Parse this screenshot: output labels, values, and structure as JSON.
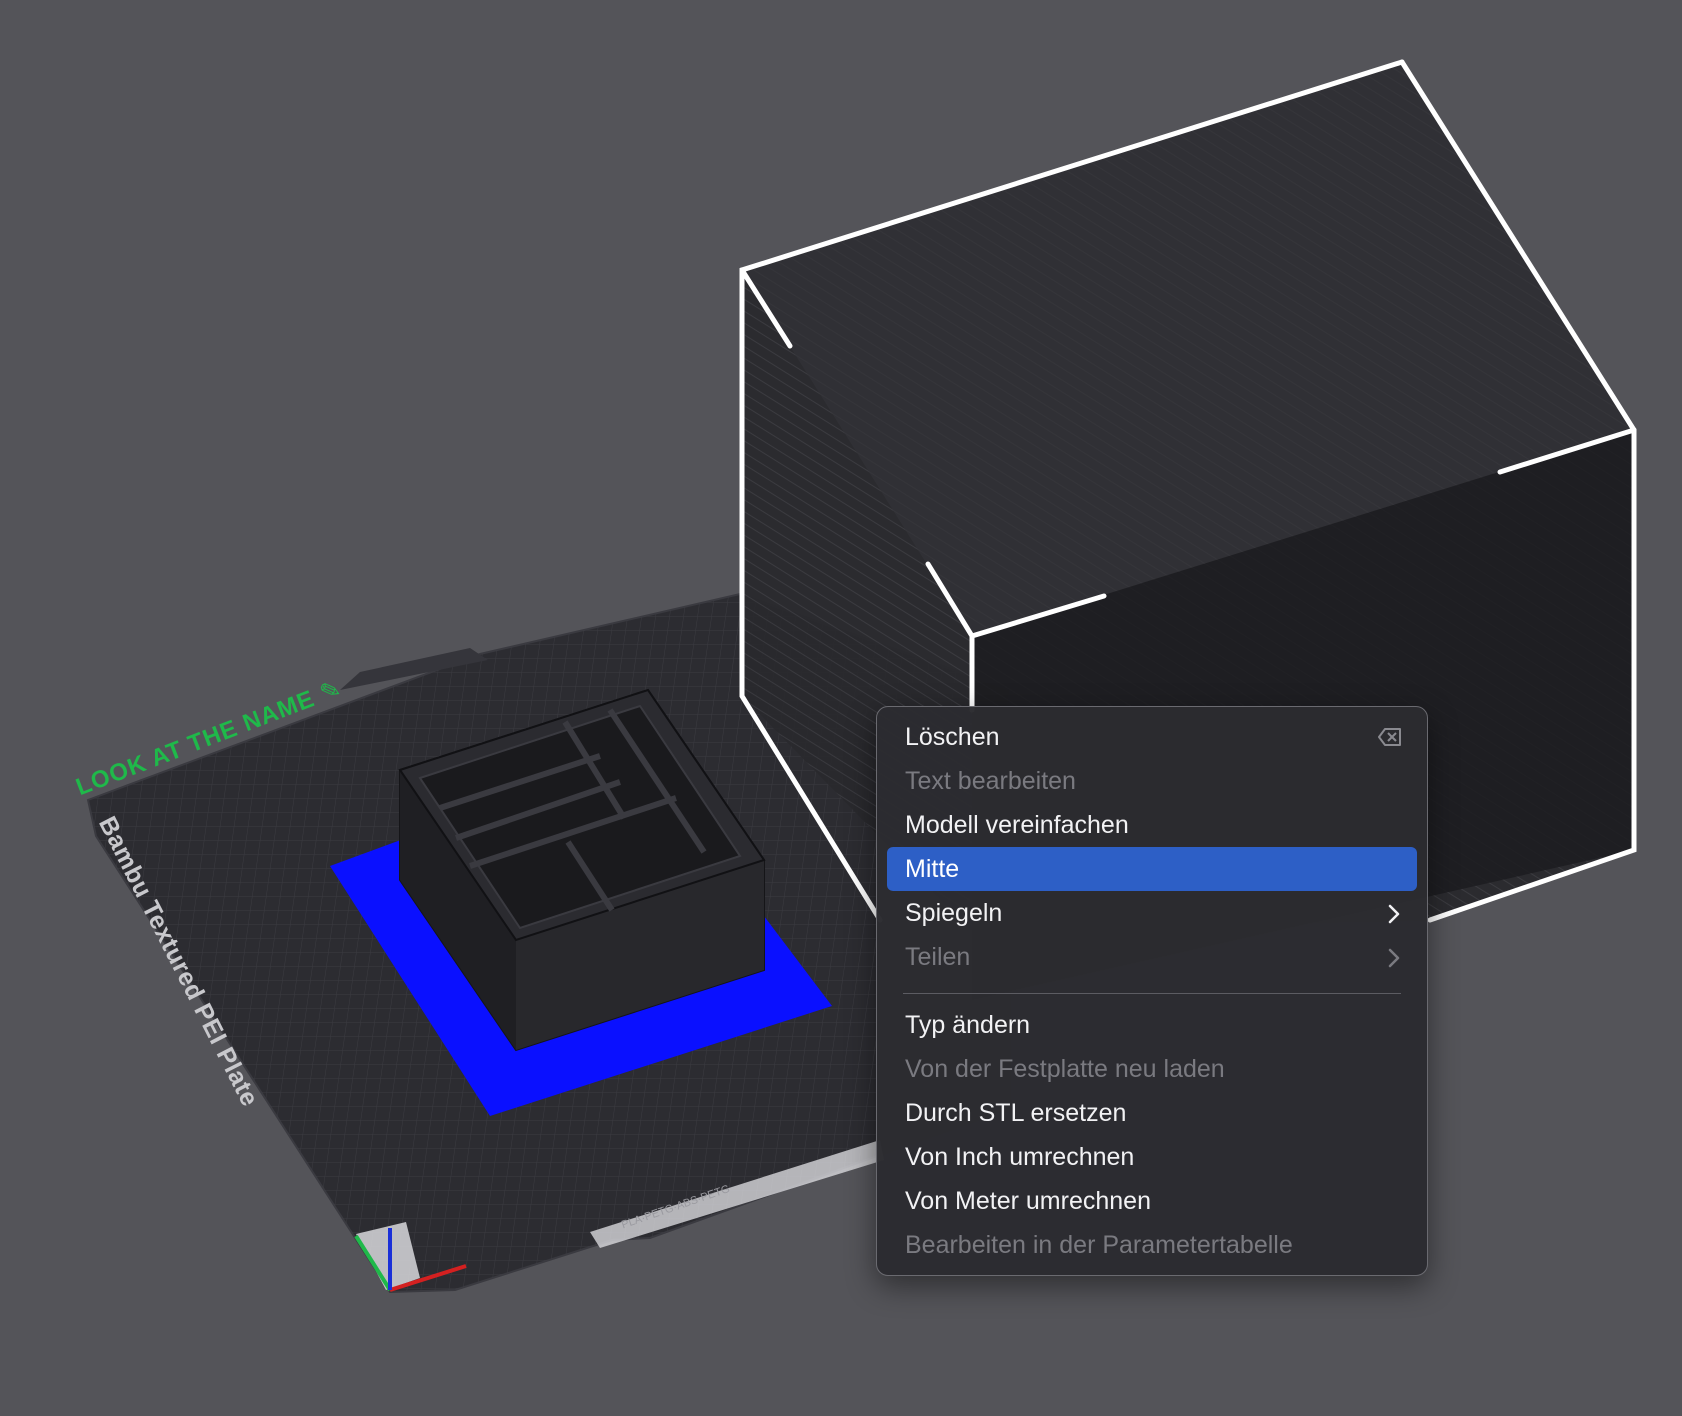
{
  "viewport": {
    "background": "#545459",
    "plate": {
      "label": "Bambu Textured PEI Plate",
      "name": "LOOK AT THE NAME",
      "name_color": "#1fb94a",
      "code_text": "PLA·PETG·ABS·PETG"
    },
    "selected_object_color": "#0a10ff"
  },
  "context_menu": {
    "highlight_color": "#2d5fc6",
    "items": [
      {
        "label": "Löschen",
        "enabled": true,
        "shortcut_icon": "delete-key-icon"
      },
      {
        "label": "Text bearbeiten",
        "enabled": false
      },
      {
        "label": "Modell vereinfachen",
        "enabled": true
      },
      {
        "label": "Mitte",
        "enabled": true,
        "highlighted": true
      },
      {
        "label": "Spiegeln",
        "enabled": true,
        "submenu": true
      },
      {
        "label": "Teilen",
        "enabled": false,
        "submenu": true
      },
      {
        "label": "Typ ändern",
        "enabled": true
      },
      {
        "label": "Von der Festplatte neu laden",
        "enabled": false
      },
      {
        "label": "Durch STL ersetzen",
        "enabled": true
      },
      {
        "label": "Von Inch umrechnen",
        "enabled": true
      },
      {
        "label": "Von Meter umrechnen",
        "enabled": true
      },
      {
        "label": "Bearbeiten in der Parametertabelle",
        "enabled": false
      }
    ]
  }
}
